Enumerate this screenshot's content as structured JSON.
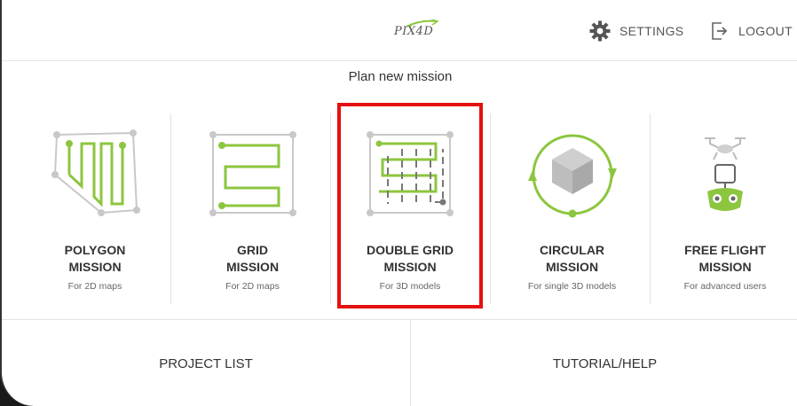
{
  "header": {
    "logo_text": "PIX4D",
    "settings_label": "SETTINGS",
    "logout_label": "LOGOUT"
  },
  "plan_title": "Plan new mission",
  "missions": [
    {
      "name": "POLYGON\nMISSION",
      "sub": "For 2D maps",
      "icon": "polygon-mission-icon"
    },
    {
      "name": "GRID\nMISSION",
      "sub": "For 2D maps",
      "icon": "grid-mission-icon"
    },
    {
      "name": "DOUBLE GRID\nMISSION",
      "sub": "For 3D models",
      "icon": "double-grid-mission-icon"
    },
    {
      "name": "CIRCULAR\nMISSION",
      "sub": "For single 3D models",
      "icon": "circular-mission-icon"
    },
    {
      "name": "FREE FLIGHT\nMISSION",
      "sub": "For advanced users",
      "icon": "free-flight-mission-icon"
    }
  ],
  "bottom": {
    "project_list_label": "PROJECT LIST",
    "tutorial_label": "TUTORIAL/HELP"
  },
  "colors": {
    "accent_green": "#8cc63f",
    "highlight_red": "#e41010"
  }
}
